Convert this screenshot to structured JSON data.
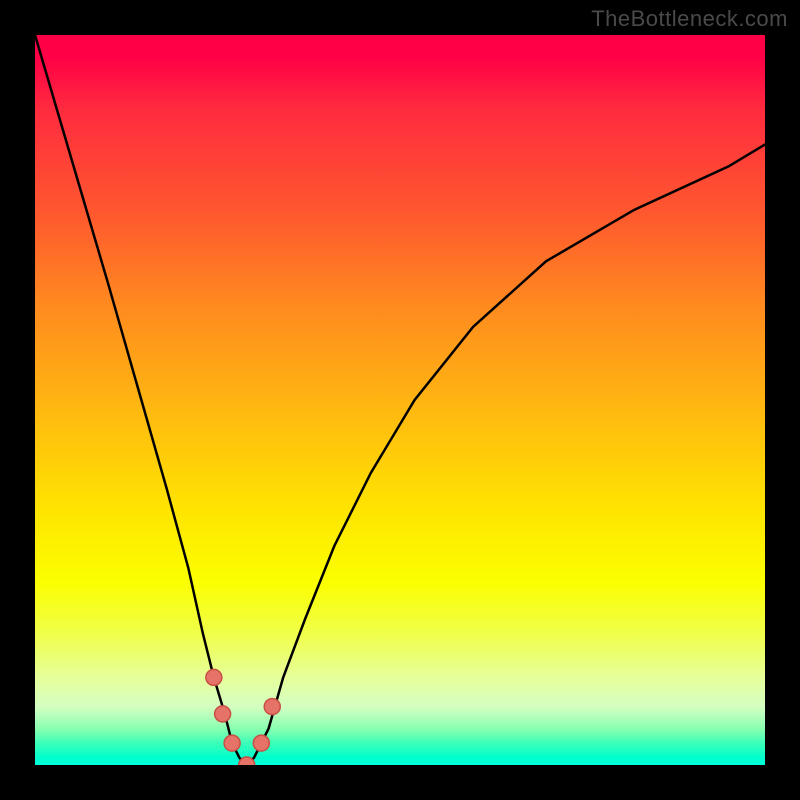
{
  "watermark": "TheBottleneck.com",
  "chart_data": {
    "type": "line",
    "title": "",
    "xlabel": "",
    "ylabel": "",
    "xlim": [
      0,
      100
    ],
    "ylim": [
      0,
      100
    ],
    "grid": false,
    "legend": false,
    "background_gradient": {
      "top": "#ff0046",
      "mid": "#ffe400",
      "bottom": "#00ffdd"
    },
    "series": [
      {
        "name": "bottleneck-curve",
        "color": "#000000",
        "x": [
          0,
          5,
          10,
          14,
          18,
          21,
          23,
          24.5,
          26,
          27,
          28,
          29,
          30,
          32,
          34,
          37,
          41,
          46,
          52,
          60,
          70,
          82,
          95,
          100
        ],
        "values": [
          100,
          83,
          66,
          52,
          38,
          27,
          18,
          12,
          7,
          3,
          1,
          0,
          1,
          5,
          12,
          20,
          30,
          40,
          50,
          60,
          69,
          76,
          82,
          85
        ]
      }
    ],
    "markers": {
      "name": "highlight-dots",
      "color": "#e57368",
      "x": [
        24.5,
        25.7,
        27.0,
        29.0,
        31.0,
        32.5
      ],
      "values": [
        12.0,
        7.0,
        3.0,
        0.0,
        3.0,
        8.0
      ]
    }
  }
}
